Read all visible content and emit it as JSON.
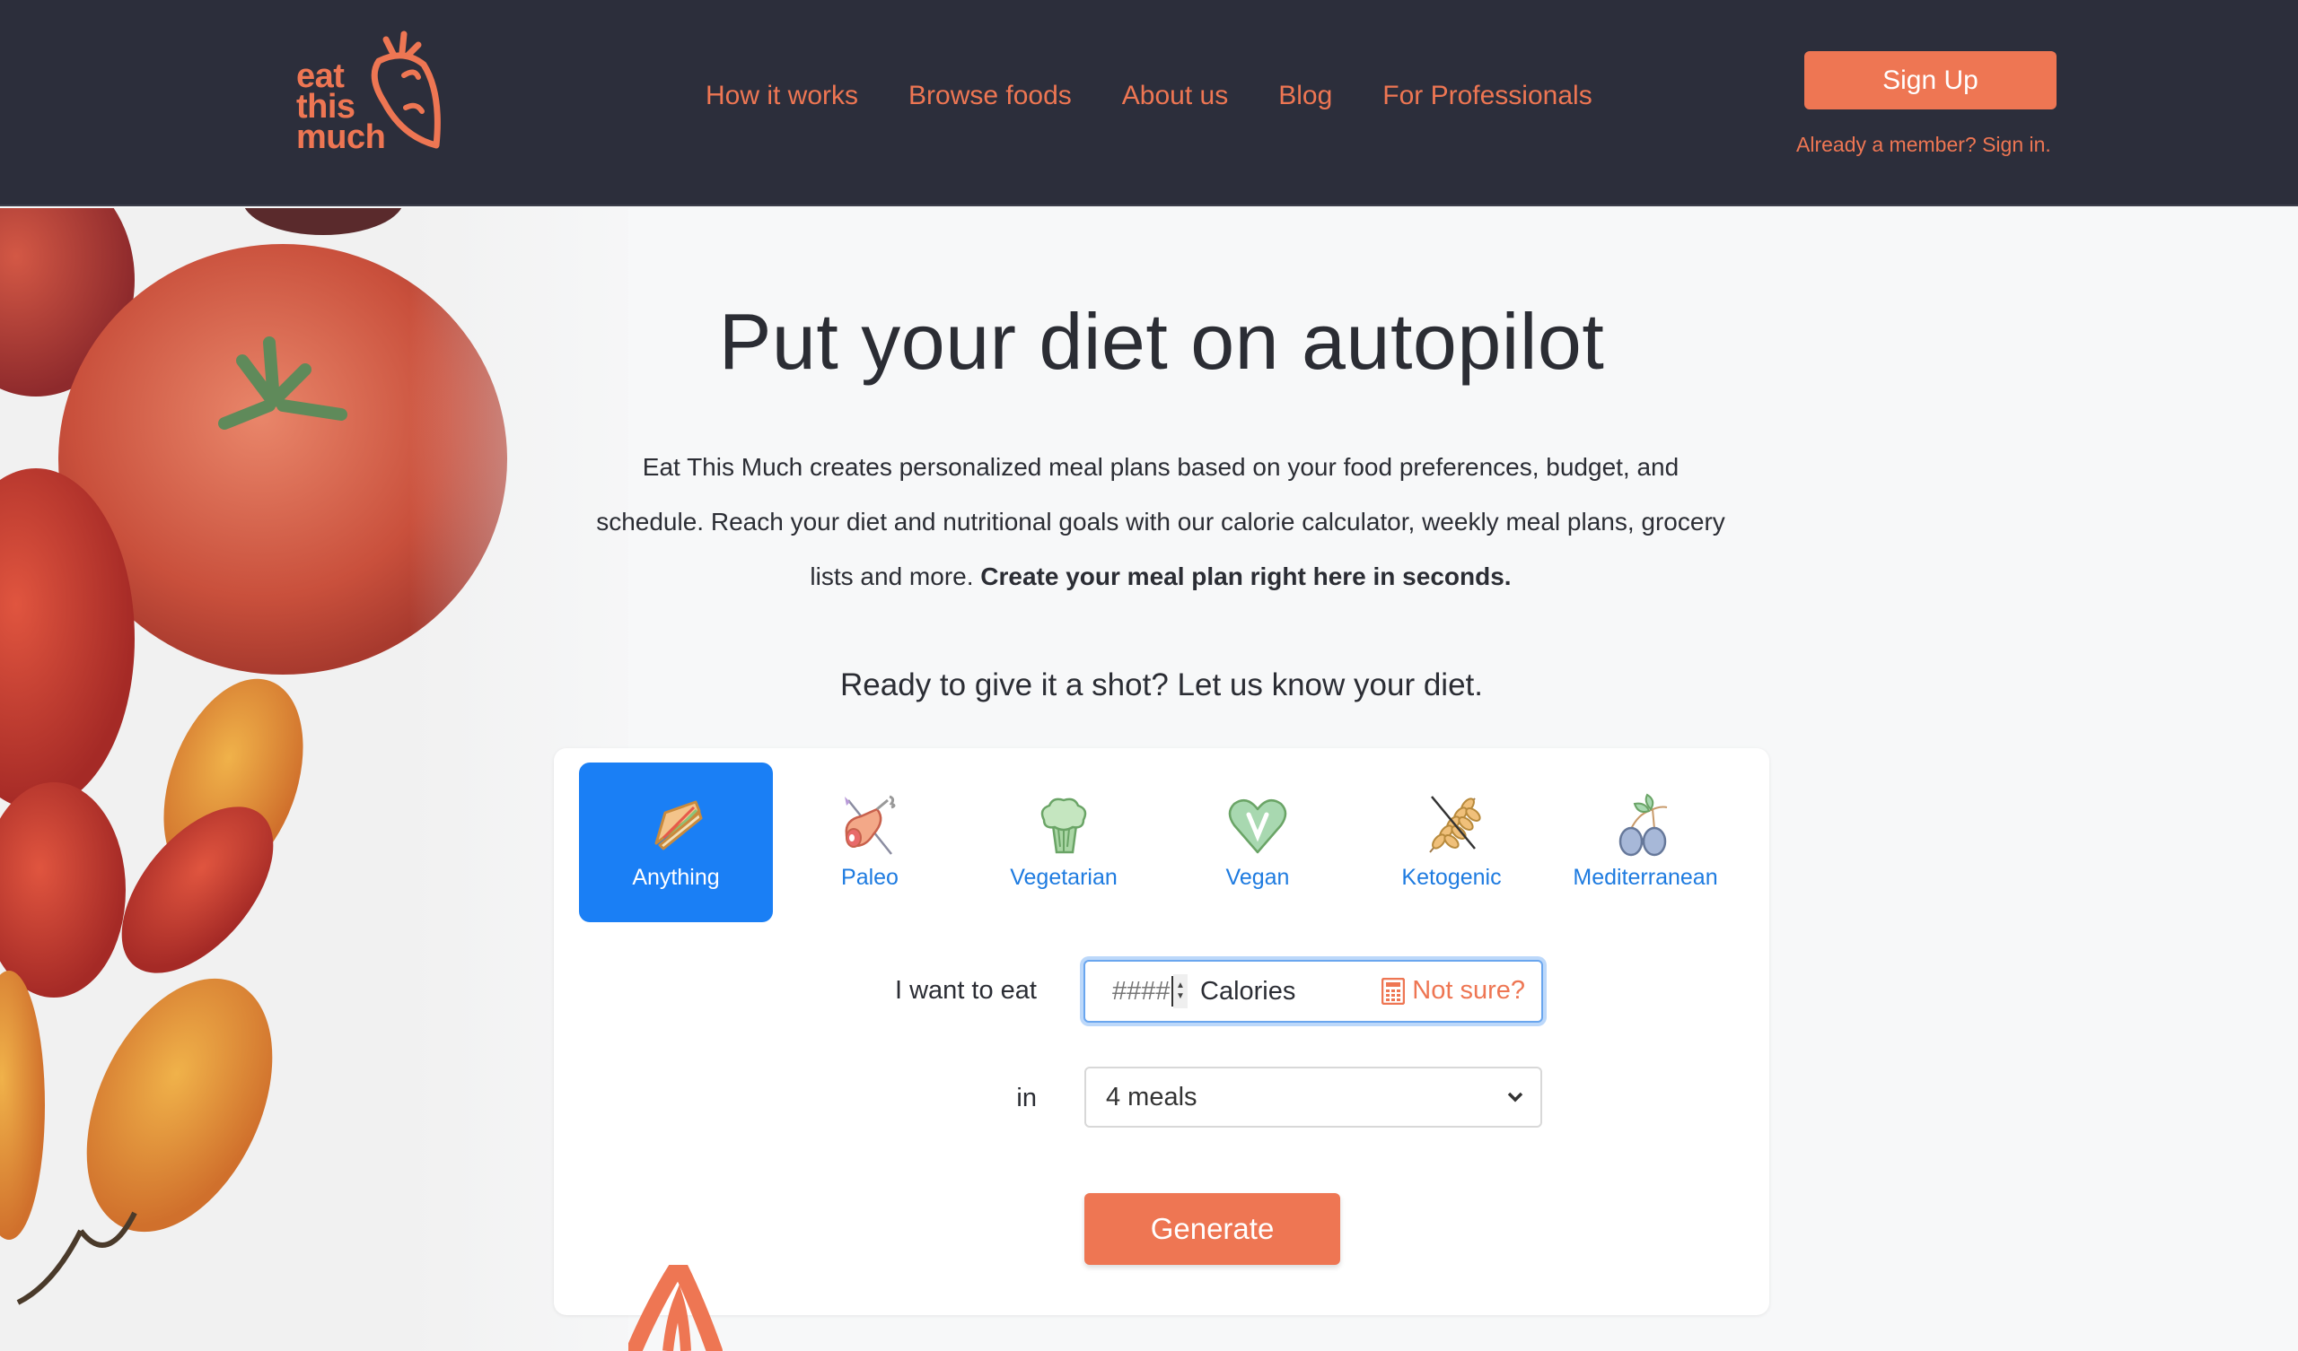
{
  "brand": {
    "logo_lines": [
      "eat",
      "this",
      "much"
    ],
    "accent_color": "#ee7653",
    "header_bg": "#2c2e3b",
    "selected_color": "#1a7ff5"
  },
  "nav": {
    "items": [
      {
        "label": "How it works"
      },
      {
        "label": "Browse foods"
      },
      {
        "label": "About us"
      },
      {
        "label": "Blog"
      },
      {
        "label": "For Professionals"
      }
    ]
  },
  "auth": {
    "signup_label": "Sign Up",
    "signin_text": "Already a member? Sign in."
  },
  "hero": {
    "headline": "Put your diet on autopilot",
    "intro_text": "Eat This Much creates personalized meal plans based on your food preferences, budget, and schedule. Reach your diet and nutritional goals with our calorie calculator, weekly meal plans, grocery lists and more.",
    "intro_bold": "Create your meal plan right here in seconds.",
    "prompt": "Ready to give it a shot? Let us know your diet.",
    "image": "tomatoes-photo"
  },
  "planner": {
    "diets": [
      {
        "label": "Anything",
        "icon": "sandwich-icon",
        "selected": true
      },
      {
        "label": "Paleo",
        "icon": "meat-drumstick-icon",
        "selected": false
      },
      {
        "label": "Vegetarian",
        "icon": "broccoli-icon",
        "selected": false
      },
      {
        "label": "Vegan",
        "icon": "vegan-heart-icon",
        "selected": false
      },
      {
        "label": "Ketogenic",
        "icon": "no-grain-icon",
        "selected": false
      },
      {
        "label": "Mediterranean",
        "icon": "olives-icon",
        "selected": false
      }
    ],
    "calories_label": "I want to eat",
    "calories_placeholder": "####",
    "calories_value": "",
    "calories_unit": "Calories",
    "not_sure_label": "Not sure?",
    "meals_label": "in",
    "meals_selected": "4 meals",
    "generate_label": "Generate"
  }
}
